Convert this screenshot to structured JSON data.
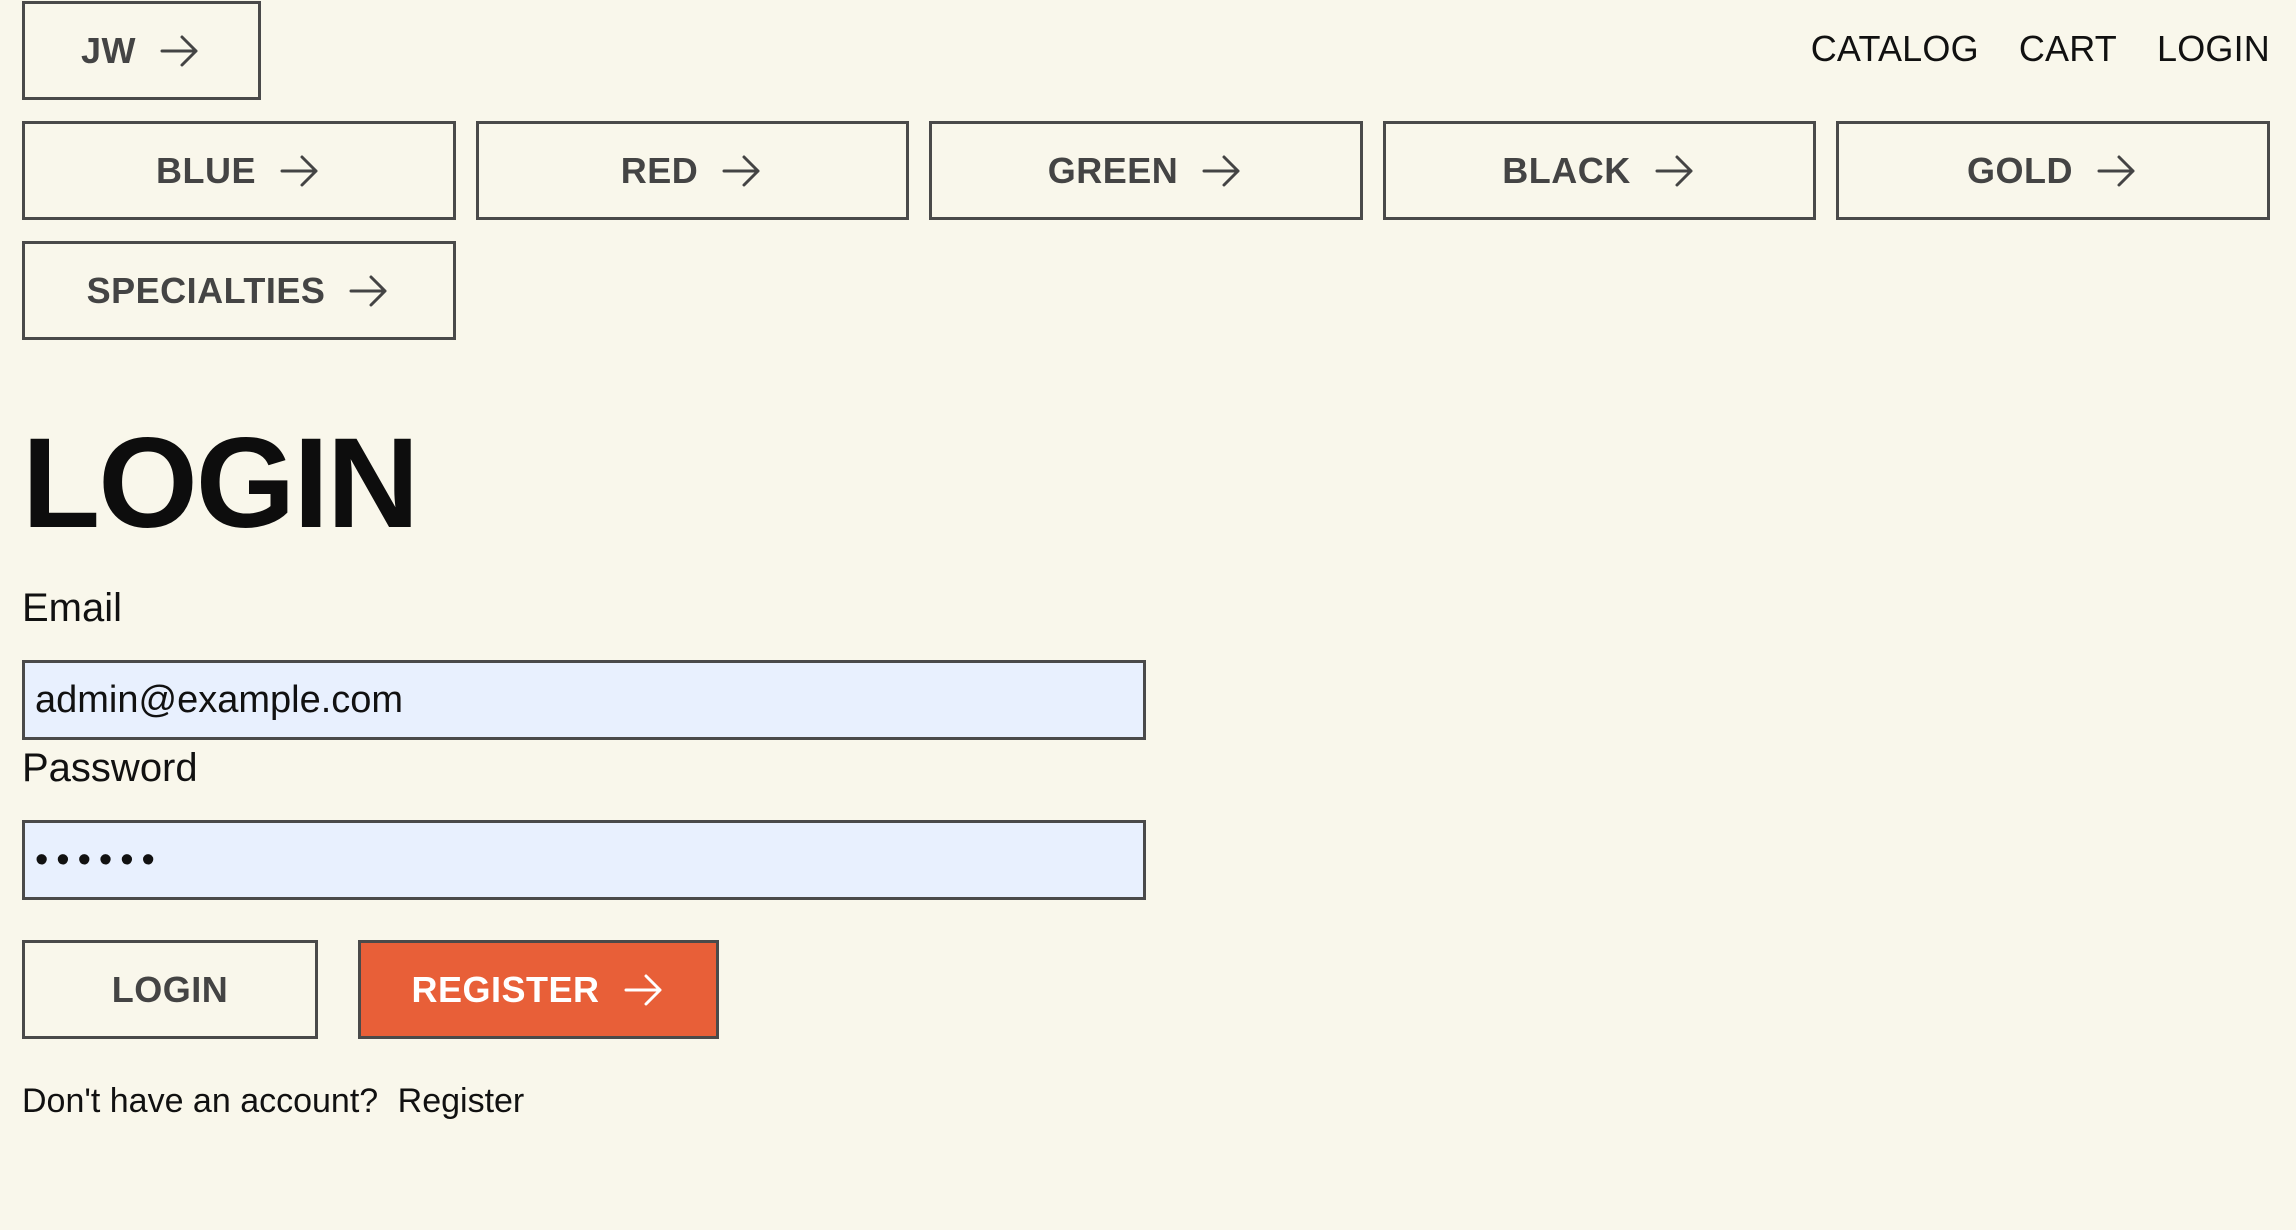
{
  "header": {
    "home_label": "JW",
    "nav": [
      {
        "label": "CATALOG"
      },
      {
        "label": "CART"
      },
      {
        "label": "LOGIN"
      }
    ]
  },
  "categories": [
    {
      "label": "BLUE"
    },
    {
      "label": "RED"
    },
    {
      "label": "GREEN"
    },
    {
      "label": "BLACK"
    },
    {
      "label": "GOLD"
    },
    {
      "label": "SPECIALTIES"
    }
  ],
  "form": {
    "title": "LOGIN",
    "email_label": "Email",
    "email_value": "admin@example.com",
    "password_label": "Password",
    "password_value": "••••••",
    "login_button": "LOGIN",
    "register_button": "REGISTER",
    "footer_prompt": "Don't have an account?",
    "footer_link": "Register"
  },
  "colors": {
    "background": "#f9f7eb",
    "accent": "#e85f38",
    "input_background": "#e8f0fe",
    "border": "#4a4a4a"
  },
  "icons": {
    "button_arrow": "arrow-right-icon"
  }
}
